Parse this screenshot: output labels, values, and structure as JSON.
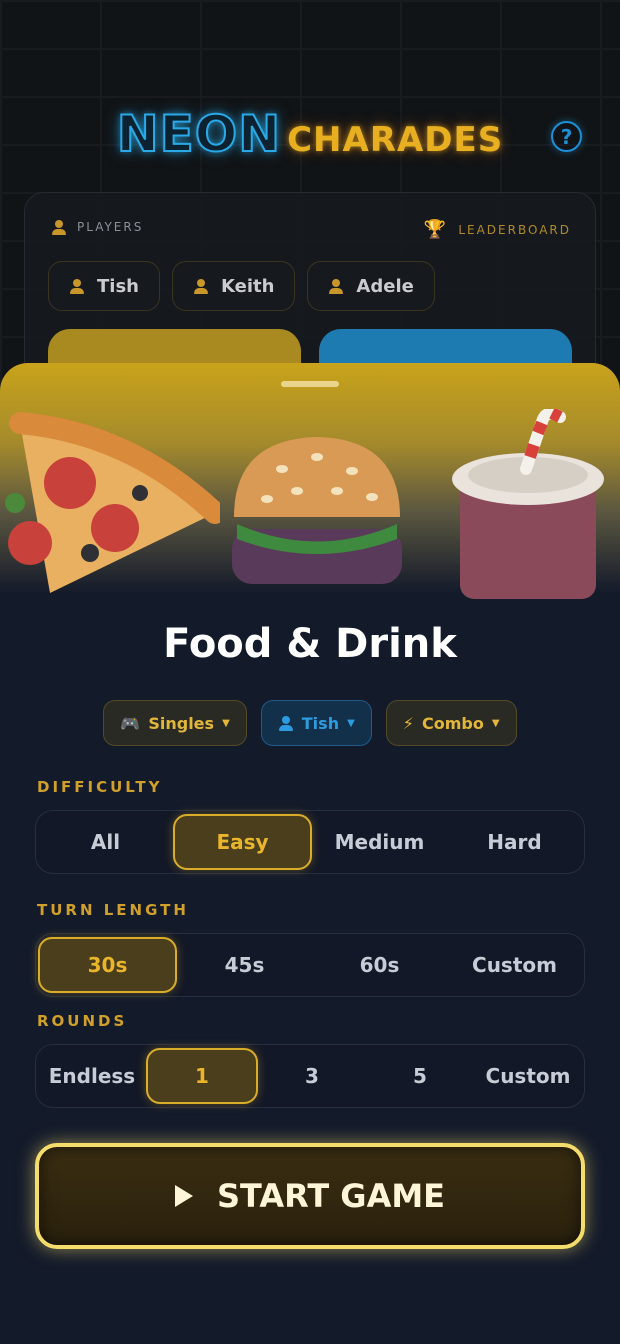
{
  "header": {
    "logo_neon": "NEON",
    "logo_charades": "CHARADES",
    "help_icon": "?"
  },
  "players_card": {
    "players_label": "PLAYERS",
    "leaderboard_label": "LEADERBOARD",
    "players": [
      "Tish",
      "Keith",
      "Adele"
    ]
  },
  "category": {
    "title": "Food & Drink",
    "mode_pill": "Singles",
    "player_pill": "Tish",
    "type_pill": "Combo"
  },
  "difficulty": {
    "label": "DIFFICULTY",
    "options": [
      "All",
      "Easy",
      "Medium",
      "Hard"
    ],
    "selected": "Easy"
  },
  "turn_length": {
    "label": "TURN LENGTH",
    "options": [
      "30s",
      "45s",
      "60s",
      "Custom"
    ],
    "selected": "30s"
  },
  "rounds": {
    "label": "ROUNDS",
    "options": [
      "Endless",
      "1",
      "3",
      "5",
      "Custom"
    ],
    "selected": "1"
  },
  "start_button": "START GAME",
  "icons": {
    "mode": "gamepad-icon",
    "player": "person-icon",
    "type": "lightning-icon",
    "leaderboard": "trophy-icon",
    "help": "help-icon",
    "start": "play-icon"
  },
  "colors": {
    "accent_gold": "#d9ad2a",
    "accent_blue": "#1c8fd6",
    "background": "#131a2a"
  }
}
